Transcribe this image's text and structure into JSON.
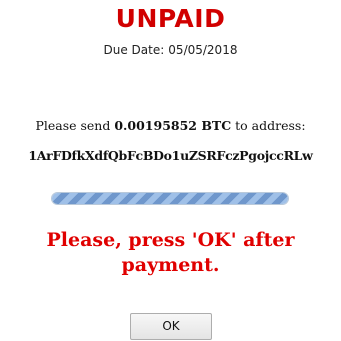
{
  "status": {
    "title": "UNPAID",
    "color": "#d10000"
  },
  "due": {
    "label": "Due Date:",
    "date": "05/05/2018"
  },
  "payment": {
    "prefix": "Please send",
    "amount": "0.00195852 BTC",
    "suffix": "to address:",
    "address": "1ArFDfkXdfQbFcBDo1uZSRFczPgojccRLw"
  },
  "progress": {
    "value": 1.0
  },
  "instruction": {
    "line1": "Please, press 'OK' after",
    "line2": "payment."
  },
  "ok_button": {
    "label": "OK"
  }
}
